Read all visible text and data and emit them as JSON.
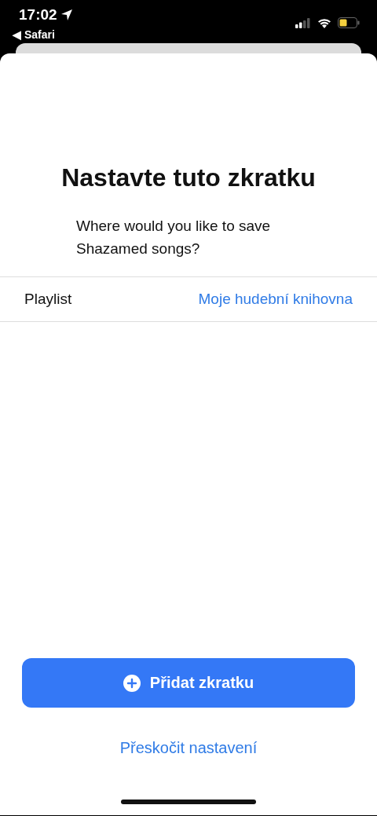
{
  "status_bar": {
    "time": "17:02",
    "back_app": "◀ Safari"
  },
  "sheet": {
    "title": "Nastavte tuto zkratku",
    "prompt": "Where would you like to save Shazamed songs?",
    "settings": [
      {
        "label": "Playlist",
        "value": "Moje hudební knihovna"
      }
    ],
    "primary_button": "Přidat zkratku",
    "secondary_link": "Přeskočit nastavení"
  }
}
